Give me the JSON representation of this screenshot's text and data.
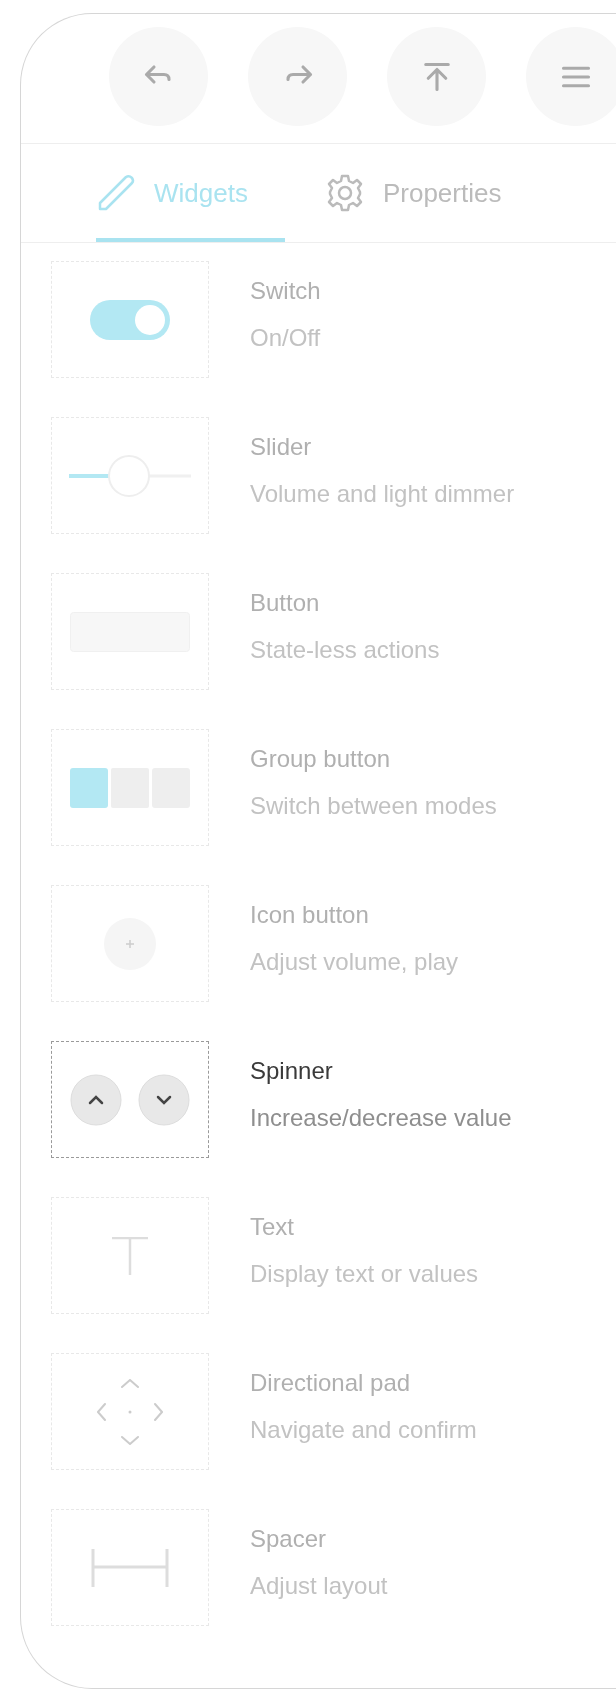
{
  "tabs": [
    {
      "label": "Widgets",
      "selected": true
    },
    {
      "label": "Properties",
      "selected": false
    }
  ],
  "widgets": [
    {
      "kind": "switch",
      "title": "Switch",
      "description": "On/Off",
      "selected": false
    },
    {
      "kind": "slider",
      "title": "Slider",
      "description": "Volume and light dimmer",
      "selected": false
    },
    {
      "kind": "button",
      "title": "Button",
      "description": "State-less actions",
      "selected": false
    },
    {
      "kind": "group",
      "title": "Group button",
      "description": "Switch between modes",
      "selected": false
    },
    {
      "kind": "iconbutton",
      "title": "Icon button",
      "description": "Adjust volume, play",
      "selected": false
    },
    {
      "kind": "spinner",
      "title": "Spinner",
      "description": "Increase/decrease value",
      "selected": true
    },
    {
      "kind": "text",
      "title": "Text",
      "description": "Display text or values",
      "selected": false
    },
    {
      "kind": "dpad",
      "title": "Directional pad",
      "description": "Navigate and confirm",
      "selected": false
    },
    {
      "kind": "spacer",
      "title": "Spacer",
      "description": "Adjust layout",
      "selected": false
    }
  ]
}
